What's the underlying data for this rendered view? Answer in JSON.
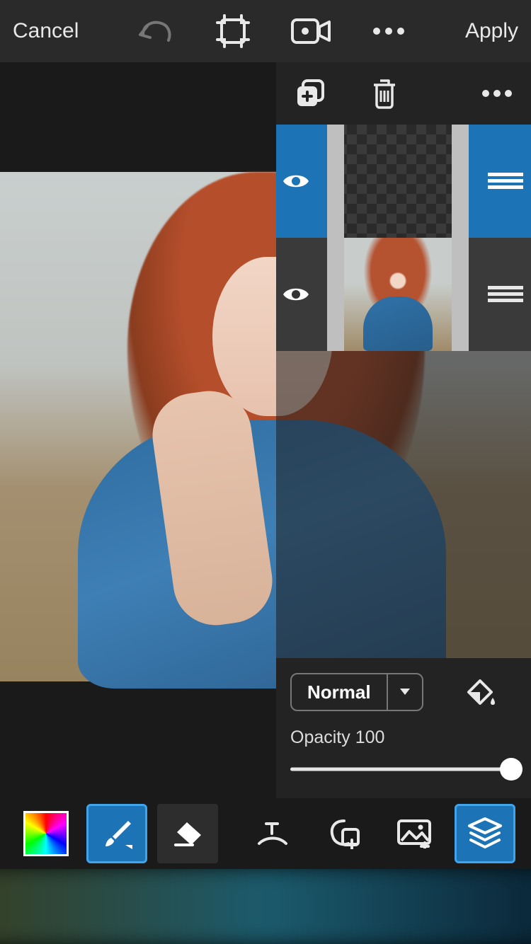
{
  "topbar": {
    "cancel_label": "Cancel",
    "apply_label": "Apply"
  },
  "layers": {
    "items": [
      {
        "visible": true,
        "selected": true,
        "type": "transparent"
      },
      {
        "visible": true,
        "selected": false,
        "type": "photo"
      }
    ]
  },
  "blend": {
    "mode_label": "Normal",
    "opacity_label": "Opacity 100",
    "opacity_value": 100
  },
  "colors": {
    "accent": "#1c73b5",
    "accent_border": "#41a4ea"
  }
}
